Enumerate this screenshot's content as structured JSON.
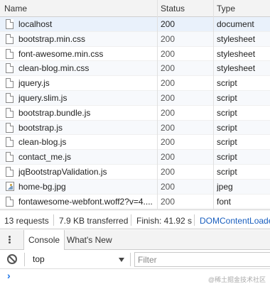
{
  "network": {
    "columns": {
      "name": "Name",
      "status": "Status",
      "type": "Type"
    },
    "rows": [
      {
        "name": "localhost",
        "status": "200",
        "type": "document",
        "icon": "file-icon"
      },
      {
        "name": "bootstrap.min.css",
        "status": "200",
        "type": "stylesheet",
        "icon": "file-icon"
      },
      {
        "name": "font-awesome.min.css",
        "status": "200",
        "type": "stylesheet",
        "icon": "file-icon"
      },
      {
        "name": "clean-blog.min.css",
        "status": "200",
        "type": "stylesheet",
        "icon": "file-icon"
      },
      {
        "name": "jquery.js",
        "status": "200",
        "type": "script",
        "icon": "file-icon"
      },
      {
        "name": "jquery.slim.js",
        "status": "200",
        "type": "script",
        "icon": "file-icon"
      },
      {
        "name": "bootstrap.bundle.js",
        "status": "200",
        "type": "script",
        "icon": "file-icon"
      },
      {
        "name": "bootstrap.js",
        "status": "200",
        "type": "script",
        "icon": "file-icon"
      },
      {
        "name": "clean-blog.js",
        "status": "200",
        "type": "script",
        "icon": "file-icon"
      },
      {
        "name": "contact_me.js",
        "status": "200",
        "type": "script",
        "icon": "file-icon"
      },
      {
        "name": "jqBootstrapValidation.js",
        "status": "200",
        "type": "script",
        "icon": "file-icon"
      },
      {
        "name": "home-bg.jpg",
        "status": "200",
        "type": "jpeg",
        "icon": "image-icon"
      },
      {
        "name": "fontawesome-webfont.woff2?v=4....",
        "status": "200",
        "type": "font",
        "icon": "file-icon"
      }
    ],
    "selected_row": 0
  },
  "summary": {
    "requests": "13 requests",
    "transferred": "7.9 KB transferred",
    "finish": "Finish: 41.92 s",
    "dom_content_loaded": "DOMContentLoade"
  },
  "drawer": {
    "tabs": [
      "Console",
      "What's New"
    ],
    "active_tab": "Console"
  },
  "console_bar": {
    "context": "top",
    "filter_placeholder": "Filter"
  },
  "console": {
    "prompt": "›",
    "watermark": "@稀土掘金技术社区"
  },
  "colors": {
    "selected_row": "#e9f1fb",
    "link_blue": "#1a5fbf",
    "prompt_blue": "#1a73e8"
  }
}
